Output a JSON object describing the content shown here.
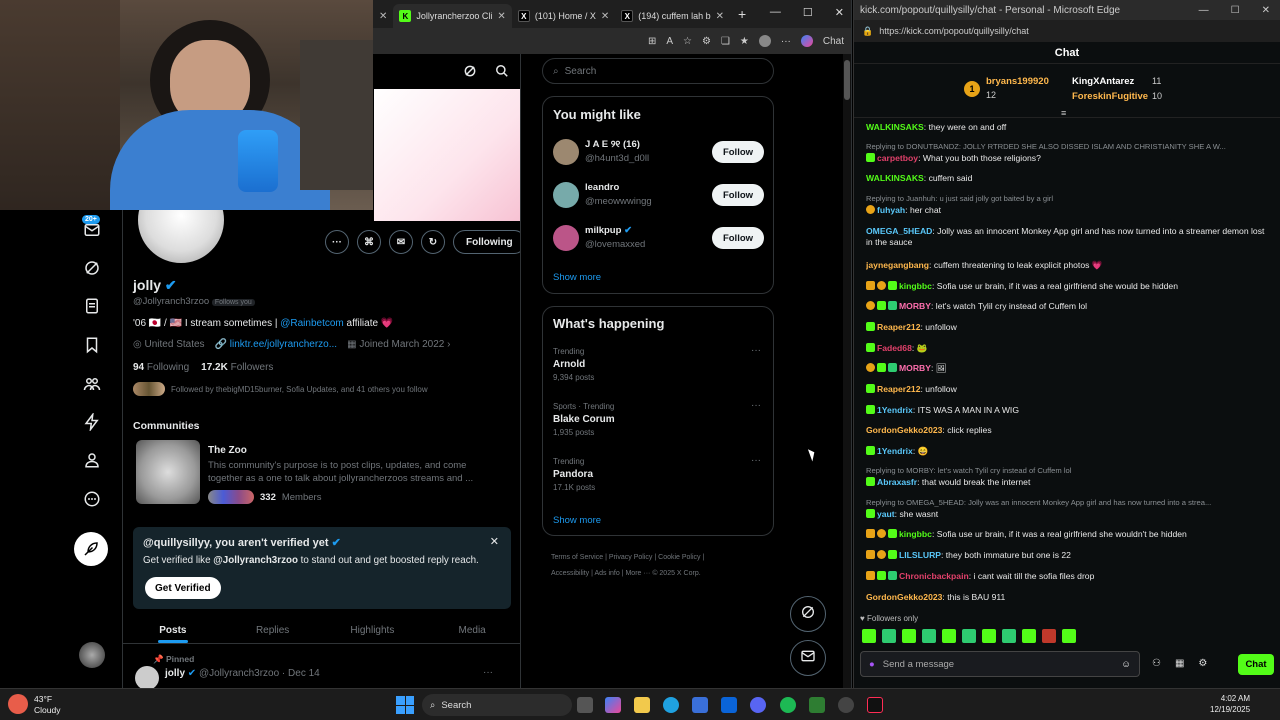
{
  "left_browser": {
    "tabs": [
      {
        "label": "Jollyrancherzoo Cli",
        "active": true
      },
      {
        "label": "(101) Home / X",
        "active": false
      },
      {
        "label": "(194) cuffem lah b",
        "active": false
      }
    ],
    "chat_button": "Chat"
  },
  "x": {
    "nav_badge": "20+",
    "search_placeholder": "Search",
    "profile": {
      "name": "jolly",
      "handle": "@Jollyranch3rzoo",
      "follows_you": "Follows you",
      "bio_prefix": "'06 🇯🇵 / 🇺🇸 I stream sometimes | ",
      "bio_link": "@Rainbetcom",
      "bio_suffix": " affiliate 💗",
      "location": "United States",
      "website": "linktr.ee/jollyrancherzo...",
      "joined": "Joined March 2022",
      "following_count": "94",
      "following_label": "Following",
      "followers_count": "17.2K",
      "followers_label": "Followers",
      "followed_by": "Followed by thebigMD15burner, Sofia Updates, and 41 others you follow",
      "following_button": "Following"
    },
    "communities": {
      "heading": "Communities",
      "name": "The Zoo",
      "desc": "This community's purpose is to post clips, updates, and come together as a one to talk about jollyrancherzoos streams and ...",
      "members_count": "332",
      "members_label": "Members"
    },
    "verify": {
      "title": "@quillysillyy, you aren't verified yet",
      "text_prefix": "Get verified like ",
      "text_handle": "@Jollyranch3rzoo",
      "text_suffix": " to stand out and get boosted reply reach.",
      "button": "Get Verified"
    },
    "tabs": [
      "Posts",
      "Replies",
      "Highlights",
      "Media"
    ],
    "pinned": {
      "label": "Pinned",
      "name": "jolly",
      "meta": "@Jollyranch3rzoo · Dec 14"
    },
    "you_might_like": {
      "heading": "You might like",
      "users": [
        {
          "name": "J A E ୨୧ (16)",
          "handle": "@h4unt3d_d0ll",
          "button": "Follow"
        },
        {
          "name": "leandro",
          "handle": "@meowwwingg",
          "button": "Follow"
        },
        {
          "name": "milkpup",
          "handle": "@lovemaxxed",
          "button": "Follow"
        }
      ],
      "show_more": "Show more"
    },
    "happening": {
      "heading": "What's happening",
      "items": [
        {
          "context": "Trending",
          "topic": "Arnold",
          "posts": "9,394 posts"
        },
        {
          "context": "Sports · Trending",
          "topic": "Blake Corum",
          "posts": "1,935 posts"
        },
        {
          "context": "Trending",
          "topic": "Pandora",
          "posts": "17.1K posts"
        }
      ],
      "show_more": "Show more"
    },
    "footer": {
      "links": [
        "Terms of Service",
        "Privacy Policy",
        "Cookie Policy",
        "Accessibility",
        "Ads info",
        "More ···",
        "© 2025 X Corp."
      ]
    }
  },
  "chat": {
    "window_title": "kick.com/popout/quillysilly/chat - Personal - Microsoft Edge",
    "url": "https://kick.com/popout/quillysilly/chat",
    "header": "Chat",
    "leaderboard": [
      {
        "name": "bryans199920",
        "count": "12"
      },
      {
        "name": "KingXAntarez",
        "count": "11"
      },
      {
        "name": "ForeskinFugitive",
        "count": "10"
      }
    ],
    "messages": [
      {
        "reply": "",
        "user": "WALKINSAKS",
        "color": "#53fc18",
        "text": "they were on and off"
      },
      {
        "reply": "Replying to DONUTBANDZ: JOLLY RTRDED SHE ALSO DISSED ISLAM AND CHRISTIANITY SHE A W...",
        "user": "carpetboy",
        "color": "#e2416b",
        "text": "What you both those religions?"
      },
      {
        "reply": "",
        "user": "WALKINSAKS",
        "color": "#53fc18",
        "text": "cuffem said"
      },
      {
        "reply": "Replying to Juanhuh: u just said jolly got baited by a girl",
        "user": "fuhyah",
        "color": "#5ac8fa",
        "text": "her chat"
      },
      {
        "reply": "",
        "user": "OMEGA_5HEAD",
        "color": "#5ac8fa",
        "text": "Jolly was an innocent Monkey App girl and has now turned into a streamer demon lost in the sauce"
      },
      {
        "reply": "",
        "user": "jaynegangbang",
        "color": "#ffb84d",
        "text": "cuffem threatening to leak explicit photos 💗"
      },
      {
        "reply": "",
        "user": "kingbbc",
        "color": "#53fc18",
        "text": "Sofia use ur brain, if it was a real girlfriend she would be hidden"
      },
      {
        "reply": "",
        "user": "MORBY",
        "color": "#ff6fae",
        "text": "let's watch Tylil cry instead of Cuffem lol"
      },
      {
        "reply": "",
        "user": "Reaper212",
        "color": "#ffb84d",
        "text": "unfollow"
      },
      {
        "reply": "",
        "user": "Faded68",
        "color": "#e2416b",
        "text": "🐸"
      },
      {
        "reply": "",
        "user": "MORBY",
        "color": "#ff6fae",
        "text": "🖼"
      },
      {
        "reply": "",
        "user": "Reaper212",
        "color": "#ffb84d",
        "text": "unfollow"
      },
      {
        "reply": "",
        "user": "1Yendrix",
        "color": "#5ac8fa",
        "text": "ITS WAS A MAN IN A WIG"
      },
      {
        "reply": "",
        "user": "GordonGekko2023",
        "color": "#ffb84d",
        "text": "click replies"
      },
      {
        "reply": "",
        "user": "1Yendrix",
        "color": "#5ac8fa",
        "text": "😄"
      },
      {
        "reply": "Replying to MORBY: let's watch Tylil cry instead of Cuffem lol",
        "user": "Abraxasfr",
        "color": "#5ac8fa",
        "text": "that would break the internet"
      },
      {
        "reply": "Replying to OMEGA_5HEAD: Jolly was an innocent Monkey App girl and has now turned into a strea...",
        "user": "yaut",
        "color": "#5ac8fa",
        "text": "she wasnt"
      },
      {
        "reply": "",
        "user": "kingbbc",
        "color": "#53fc18",
        "text": "Sofia use ur brain, if it was a real girlfriend she wouldn't be hidden"
      },
      {
        "reply": "",
        "user": "LILSLURP",
        "color": "#5ac8fa",
        "text": "they both immature but one is 22"
      },
      {
        "reply": "",
        "user": "Chronicbackpain",
        "color": "#e2416b",
        "text": "i cant wait till the sofia files drop"
      },
      {
        "reply": "",
        "user": "GordonGekko2023",
        "color": "#ffb84d",
        "text": "this is BAU 911"
      }
    ],
    "followers_only": "Followers only",
    "input_placeholder": "Send a message",
    "send_button": "Chat"
  },
  "taskbar": {
    "weather_temp": "43°F",
    "weather_desc": "Cloudy",
    "search": "Search",
    "time": "4:02 AM",
    "date": "12/19/2025"
  },
  "colors": {
    "x_blue": "#1d9bf0",
    "kick_green": "#53fc18"
  }
}
